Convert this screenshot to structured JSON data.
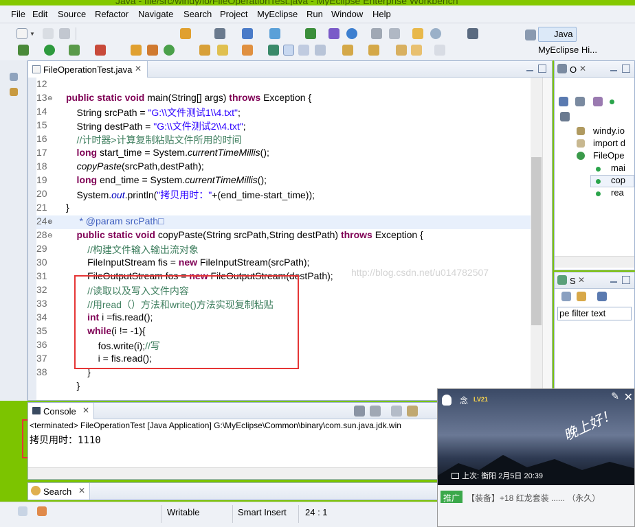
{
  "window": {
    "title": "Java - file/src/windy/io/FileOperationTest.java - MyEclipse Enterprise Workbench"
  },
  "menu": [
    "File",
    "Edit",
    "Source",
    "Refactor",
    "Navigate",
    "Search",
    "Project",
    "MyEclipse",
    "Run",
    "Window",
    "Help"
  ],
  "perspectives": {
    "java": "Java",
    "myeclipse": "MyEclipse Hi..."
  },
  "editor": {
    "tab_label": "FileOperationTest.java",
    "lines": [
      {
        "n": "12"
      },
      {
        "n": "13",
        "fold": "⊖",
        "parts": [
          {
            "t": "public static void ",
            "c": "kw"
          },
          {
            "t": "main(String[] args) "
          },
          {
            "t": "throws ",
            "c": "kw"
          },
          {
            "t": "Exception {"
          }
        ]
      },
      {
        "n": "14",
        "parts": [
          {
            "t": "    String srcPath = "
          },
          {
            "t": "\"G:\\\\文件测试1\\\\4.txt\"",
            "c": "str"
          },
          {
            "t": ";"
          }
        ]
      },
      {
        "n": "15",
        "parts": [
          {
            "t": "    String destPath = "
          },
          {
            "t": "\"G:\\\\文件测试2\\\\4.txt\"",
            "c": "str"
          },
          {
            "t": ";"
          }
        ]
      },
      {
        "n": "16",
        "parts": [
          {
            "t": "    //计时器>计算复制粘贴文件所用的时间",
            "c": "cm"
          }
        ]
      },
      {
        "n": "17",
        "parts": [
          {
            "t": "    long ",
            "c": "kw"
          },
          {
            "t": "start_time = System."
          },
          {
            "t": "currentTimeMillis",
            "c": "it"
          },
          {
            "t": "();"
          }
        ]
      },
      {
        "n": "18",
        "parts": [
          {
            "t": "    "
          },
          {
            "t": "copyPaste",
            "c": "it"
          },
          {
            "t": "(srcPath,destPath);"
          }
        ]
      },
      {
        "n": "19",
        "parts": [
          {
            "t": "    long ",
            "c": "kw"
          },
          {
            "t": "end_time = System."
          },
          {
            "t": "currentTimeMillis",
            "c": "it"
          },
          {
            "t": "();"
          }
        ]
      },
      {
        "n": "20",
        "parts": [
          {
            "t": "    System."
          },
          {
            "t": "out",
            "c": "sf"
          },
          {
            "t": ".println("
          },
          {
            "t": "\"拷贝用时：\"",
            "c": "str"
          },
          {
            "t": "+(end_time-start_time));"
          }
        ]
      },
      {
        "n": "21",
        "parts": [
          {
            "t": "}"
          }
        ]
      },
      {
        "n": "24",
        "fold": "⊕",
        "parts": [
          {
            "t": "     * @param ",
            "c": "doc"
          },
          {
            "t": "srcPath□",
            "c": "doc"
          }
        ]
      },
      {
        "n": "28",
        "fold": "⊖",
        "parts": [
          {
            "t": "    public static void ",
            "c": "kw"
          },
          {
            "t": "copyPaste(String srcPath,String destPath) "
          },
          {
            "t": "throws ",
            "c": "kw"
          },
          {
            "t": "Exception {"
          }
        ]
      },
      {
        "n": "29",
        "parts": [
          {
            "t": "        //构建文件输入输出流对象",
            "c": "cm"
          }
        ]
      },
      {
        "n": "30",
        "parts": [
          {
            "t": "        FileInputStream fis = "
          },
          {
            "t": "new ",
            "c": "kw"
          },
          {
            "t": "FileInputStream(srcPath);"
          }
        ]
      },
      {
        "n": "31",
        "parts": [
          {
            "t": "        FileOutputStream fos = "
          },
          {
            "t": "new ",
            "c": "kw"
          },
          {
            "t": "FileOutputStream(destPath);"
          }
        ]
      },
      {
        "n": "32",
        "parts": [
          {
            "t": "        //读取以及写入文件内容",
            "c": "cm"
          }
        ]
      },
      {
        "n": "33",
        "parts": [
          {
            "t": "        //用read（）方法和write()方法实现复制粘贴",
            "c": "cm"
          }
        ]
      },
      {
        "n": "34",
        "parts": [
          {
            "t": "        int ",
            "c": "kw"
          },
          {
            "t": "i =fis.read();"
          }
        ]
      },
      {
        "n": "35",
        "parts": [
          {
            "t": "        while",
            "c": "kw"
          },
          {
            "t": "(i != -1){"
          }
        ]
      },
      {
        "n": "36",
        "parts": [
          {
            "t": "            fos.write(i);"
          },
          {
            "t": "//写",
            "c": "cm"
          }
        ]
      },
      {
        "n": "37",
        "parts": [
          {
            "t": "            i = fis.read();"
          }
        ]
      },
      {
        "n": "38",
        "parts": [
          {
            "t": "        }"
          }
        ]
      },
      {
        "n": "",
        "parts": [
          {
            "t": "    }"
          }
        ]
      }
    ]
  },
  "watermark": "http://blog.csdn.net/u014782507",
  "console": {
    "tab_label": "Console",
    "status": "<terminated> FileOperationTest [Java Application] G:\\MyEclipse\\Common\\binary\\com.sun.java.jdk.win",
    "output": "拷贝用时：1110"
  },
  "search_view": {
    "tab_label": "Search"
  },
  "outline": {
    "tab_label": "O",
    "items": [
      "windy.io",
      "import d",
      "FileOpe",
      "mai",
      "cop",
      "rea"
    ]
  },
  "snippets": {
    "tab_label": "S",
    "filter_placeholder": "pe filter text"
  },
  "statusbar": {
    "writable": "Writable",
    "insert_mode": "Smart Insert",
    "position": "24 : 1"
  },
  "popup": {
    "name": "念",
    "level": "LV21",
    "greeting": "晚上好！",
    "last_login": "上次: 衡阳  2月5日 20:39",
    "tag": "推广",
    "promo": "【装备】+18 红龙套装  ......    （永久）"
  }
}
